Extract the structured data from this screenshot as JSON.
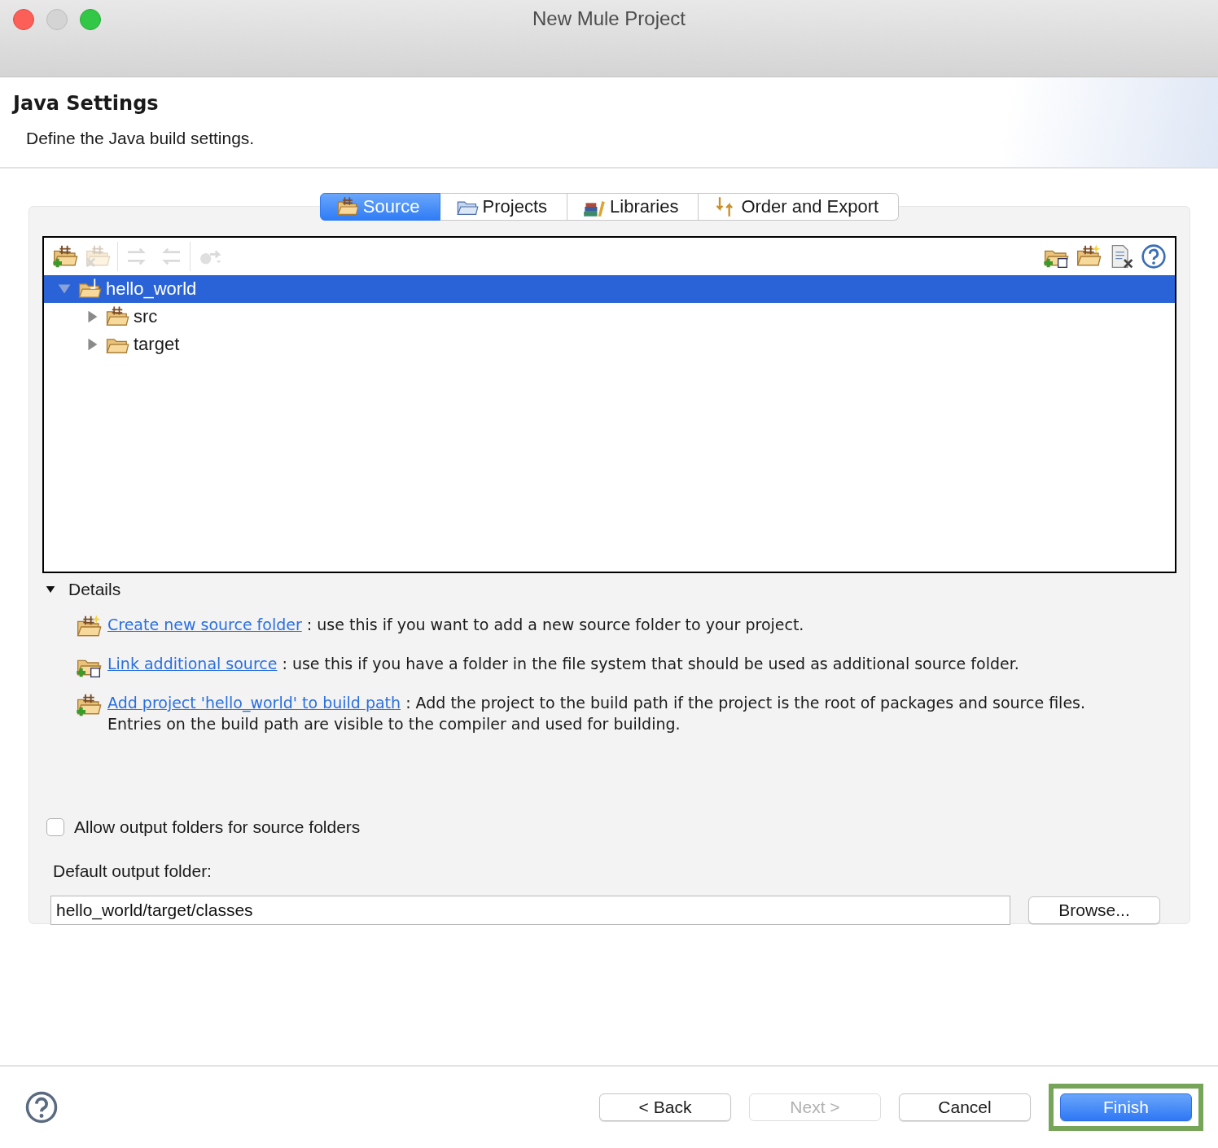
{
  "window": {
    "title": "New Mule Project"
  },
  "header": {
    "title": "Java Settings",
    "description": "Define the Java build settings."
  },
  "tabs": [
    {
      "label": "Source",
      "selected": true
    },
    {
      "label": "Projects",
      "selected": false
    },
    {
      "label": "Libraries",
      "selected": false
    },
    {
      "label": "Order and Export",
      "selected": false
    }
  ],
  "toolbar": {
    "left": [
      {
        "disabled": false
      },
      {
        "disabled": true
      },
      {
        "disabled": true
      },
      {
        "disabled": true
      },
      {
        "disabled": true
      }
    ],
    "right": [
      {
        "disabled": false
      },
      {
        "disabled": false
      },
      {
        "disabled": false
      },
      {
        "disabled": false
      }
    ]
  },
  "tree": [
    {
      "label": "hello_world",
      "kind": "project",
      "expanded": true,
      "selected": true,
      "children": [
        {
          "label": "src",
          "kind": "source_folder",
          "expanded": false,
          "selected": false
        },
        {
          "label": "target",
          "kind": "folder",
          "expanded": false,
          "selected": false
        }
      ]
    }
  ],
  "details": {
    "label": "Details",
    "expanded": true,
    "items": [
      {
        "link": "Create new source folder",
        "text": ": use this if you want to add a new source folder to your project."
      },
      {
        "link": "Link additional source",
        "text": ": use this if you have a folder in the file system that should be used as additional source folder."
      },
      {
        "link": "Add project 'hello_world' to build path",
        "text": ": Add the project to the build path if the project is the root of packages and source files. Entries on the build path are visible to the compiler and used for building."
      }
    ]
  },
  "allow_output_folders": {
    "label": "Allow output folders for source folders",
    "checked": false
  },
  "output_folder": {
    "label": "Default output folder:",
    "value": "hello_world/target/classes",
    "browse": "Browse..."
  },
  "buttons": [
    {
      "label": "< Back",
      "disabled": false,
      "default": false
    },
    {
      "label": "Next >",
      "disabled": true,
      "default": false
    },
    {
      "label": "Cancel",
      "disabled": false,
      "default": false
    },
    {
      "label": "Finish",
      "disabled": false,
      "default": true,
      "highlighted": true
    }
  ]
}
